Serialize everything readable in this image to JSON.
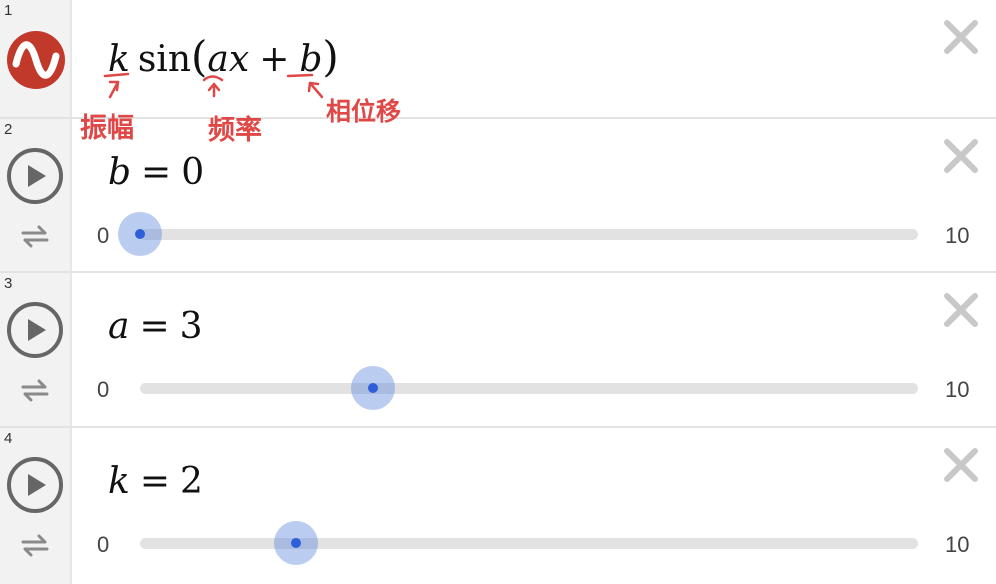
{
  "rows": [
    {
      "number": "1",
      "kind": "function",
      "expression": {
        "k": "k",
        "sin": "sin",
        "open": "(",
        "a": "a",
        "x": "x",
        "plus": "+",
        "b": "b",
        "close": ")"
      },
      "annotations": {
        "amplitude": "振幅",
        "frequency": "频率",
        "phase": "相位移"
      },
      "icon": "sine-wave-icon",
      "icon_color": "#c0392b"
    },
    {
      "number": "2",
      "kind": "slider",
      "var": "b",
      "eq": "=",
      "value": "0",
      "min": "0",
      "max": "10",
      "fraction": 0.0
    },
    {
      "number": "3",
      "kind": "slider",
      "var": "a",
      "eq": "=",
      "value": "3",
      "min": "0",
      "max": "10",
      "fraction": 0.3
    },
    {
      "number": "4",
      "kind": "slider",
      "var": "k",
      "eq": "=",
      "value": "2",
      "min": "0",
      "max": "10",
      "fraction": 0.2
    }
  ],
  "colors": {
    "slider_thumb": "#2e5fd8",
    "annotation": "#e04848",
    "close_icon": "#c8c8c8"
  }
}
